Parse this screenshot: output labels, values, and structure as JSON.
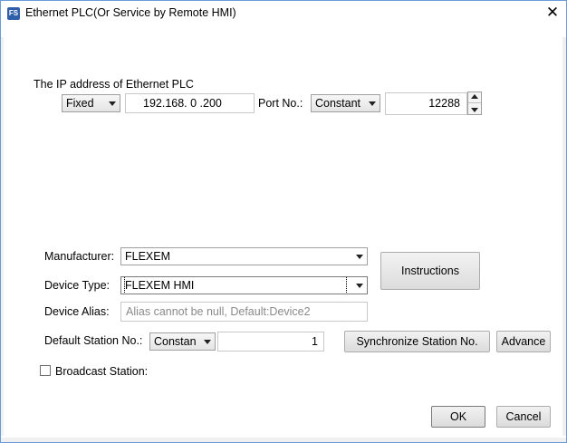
{
  "window": {
    "title": "Ethernet PLC(Or Service by Remote HMI)",
    "app_icon_text": "FS"
  },
  "ip_section": {
    "label": "The IP address of Ethernet PLC",
    "ip_mode": "Fixed",
    "ip_value": "192.168. 0 .200",
    "port_label": "Port No.:",
    "port_mode": "Constant",
    "port_value": "12288"
  },
  "device": {
    "manufacturer_label": "Manufacturer:",
    "manufacturer_value": "FLEXEM",
    "type_label": "Device Type:",
    "type_value": "FLEXEM HMI",
    "alias_label": "Device Alias:",
    "alias_placeholder": "Alias cannot be null, Default:Device2",
    "station_label": "Default Station No.:",
    "station_mode": "Constan",
    "station_value": "1",
    "instructions_label": "Instructions",
    "sync_label": "Synchronize Station No.",
    "advance_label": "Advance",
    "broadcast_label": "Broadcast Station:"
  },
  "footer": {
    "ok_label": "OK",
    "cancel_label": "Cancel"
  },
  "icons": {
    "close": "close-icon",
    "dropdown": "chevron-down-icon",
    "spin_up": "spin-up-icon",
    "spin_down": "spin-down-icon"
  },
  "colors": {
    "window_border": "#6b9ad8",
    "button_border": "#adadad"
  }
}
